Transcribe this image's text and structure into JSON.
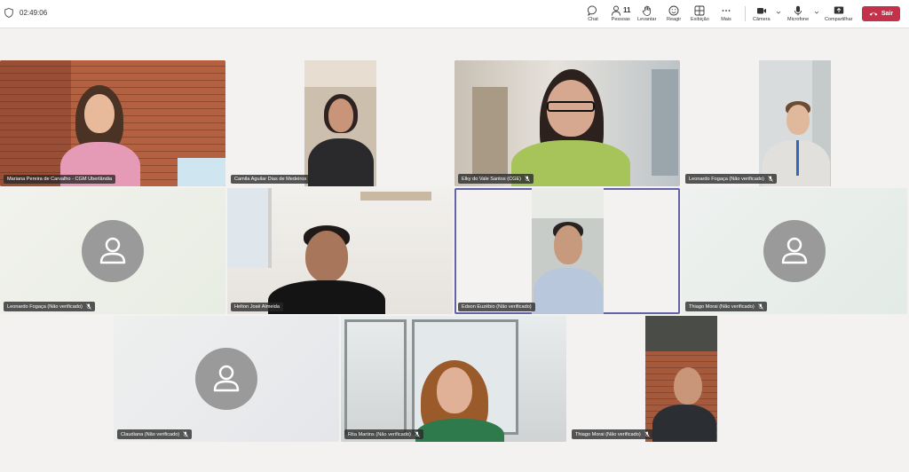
{
  "toolbar": {
    "timer": "02:49:06",
    "chat": "Chat",
    "people_label": "Pessoas",
    "people_count": "11",
    "raise": "Levantar",
    "react": "Reagir",
    "view": "Exibição",
    "more": "Mais",
    "camera": "Câmera",
    "mic": "Microfone",
    "share": "Compartilhar",
    "leave": "Sair",
    "leave_color": "#c4314b"
  },
  "participants": [
    {
      "name": "Mariana Pereira de Carvalho - CGM Uberlândia",
      "muted": false
    },
    {
      "name": "Camila Aguilar Dias de Medeiros",
      "muted": false
    },
    {
      "name": "Elky do Vale Santos (CGE)",
      "muted": true
    },
    {
      "name": "Leonardo Fogaça (Não verificado)",
      "muted": true
    },
    {
      "name": "Leonardo Fogaça (Não verificado)",
      "muted": true
    },
    {
      "name": "Helton José Almeida",
      "muted": false
    },
    {
      "name": "Edson Euzébio (Não verificado)",
      "muted": false
    },
    {
      "name": "Thiago Morai (Não verificado)",
      "muted": true
    },
    {
      "name": "Claudiana (Não verificado)",
      "muted": true
    },
    {
      "name": "Rita Martins (Não verificado)",
      "muted": true
    },
    {
      "name": "Thiago Morai (Não verificado)",
      "muted": true
    }
  ]
}
